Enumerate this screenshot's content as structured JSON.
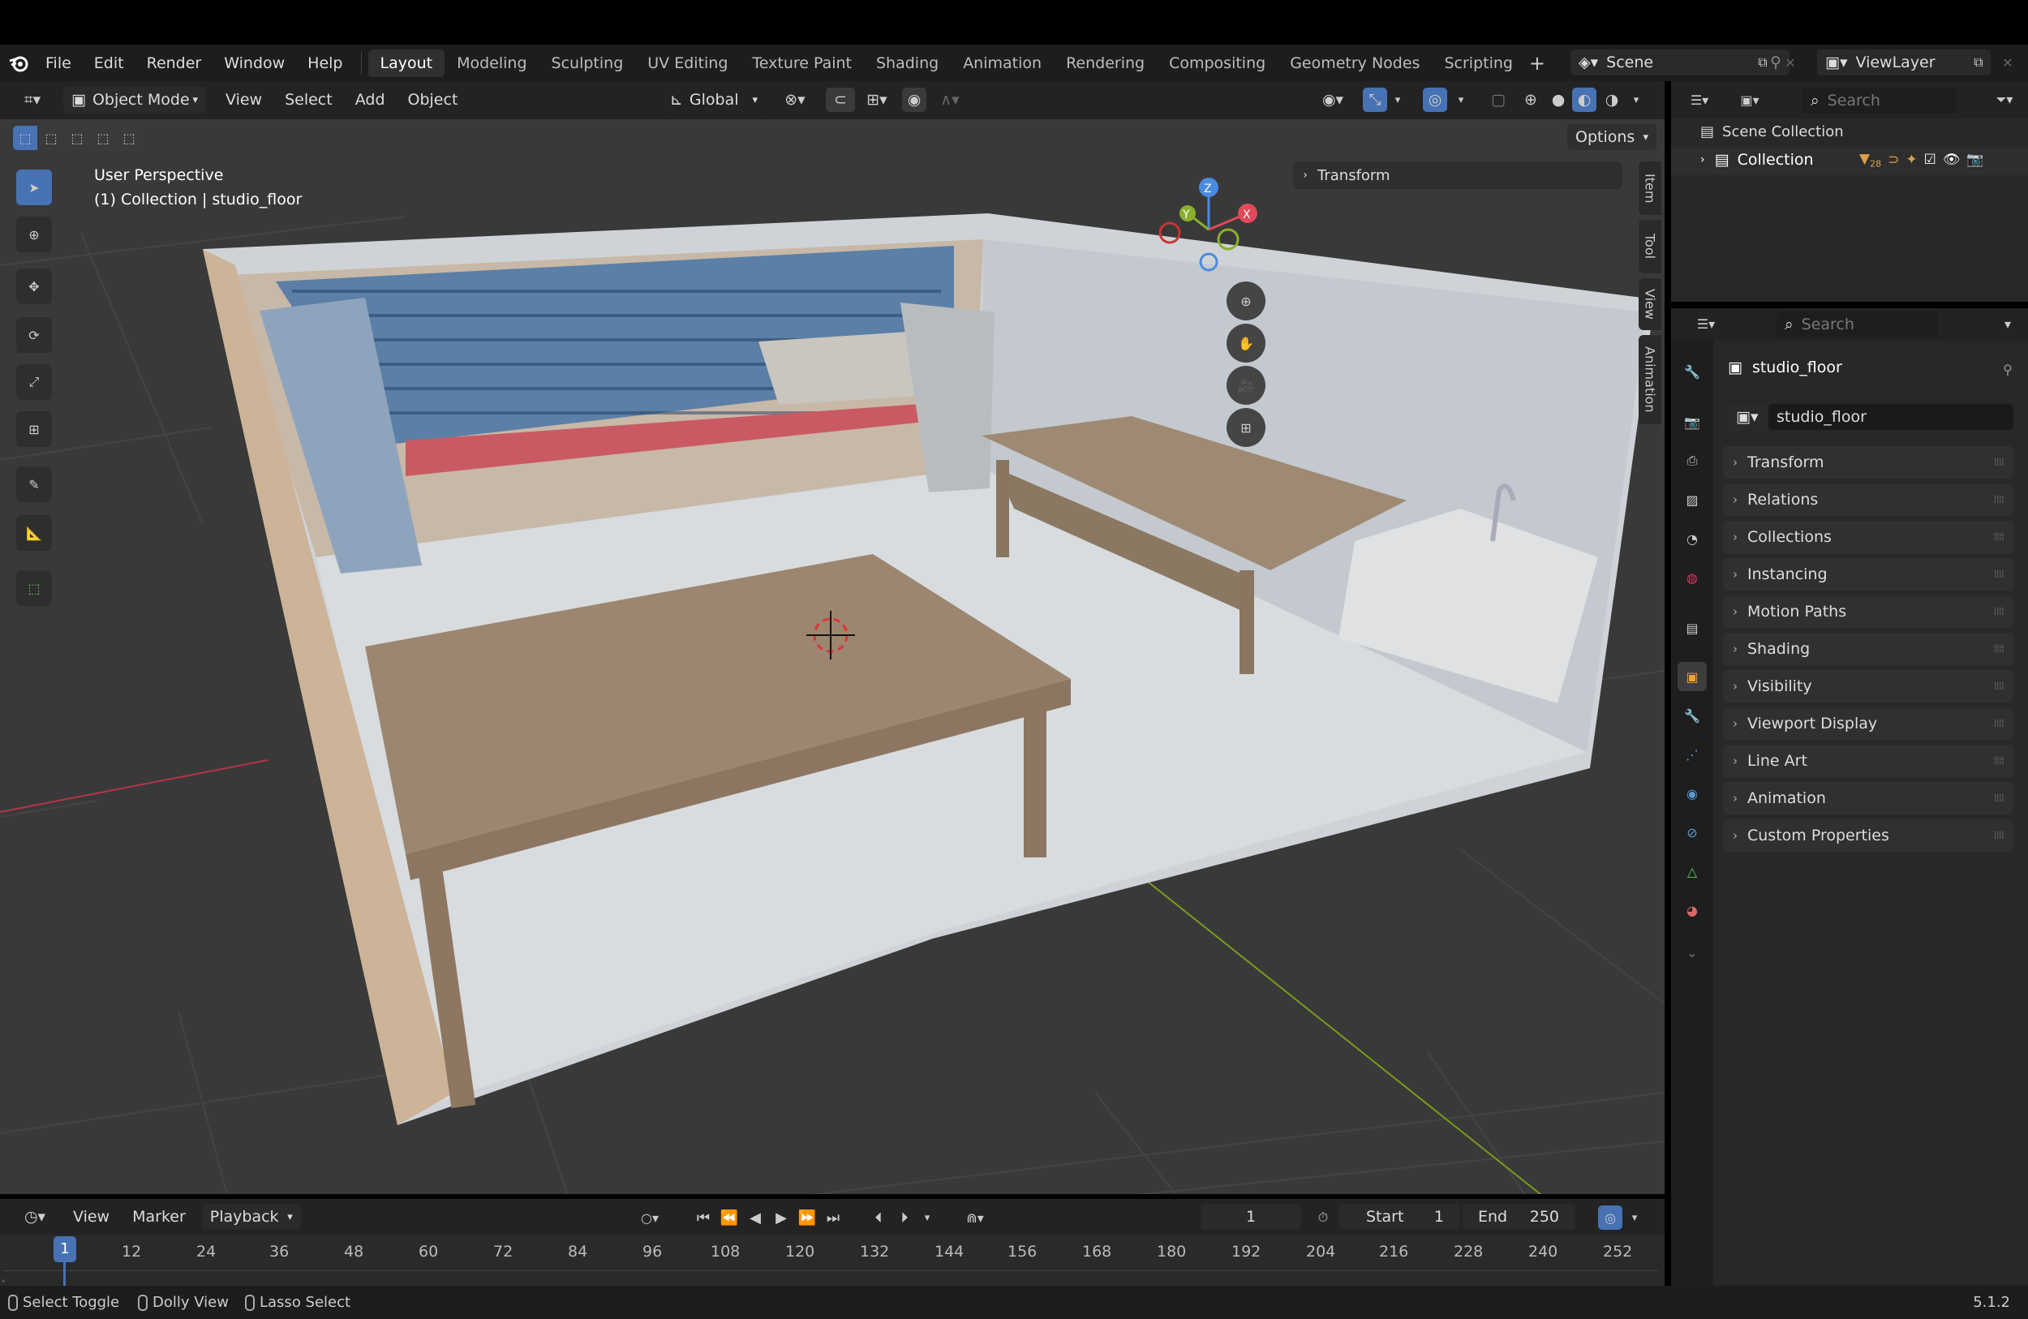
{
  "menu": [
    "File",
    "Edit",
    "Render",
    "Window",
    "Help"
  ],
  "workspaces": [
    "Layout",
    "Modeling",
    "Sculpting",
    "UV Editing",
    "Texture Paint",
    "Shading",
    "Animation",
    "Rendering",
    "Compositing",
    "Geometry Nodes",
    "Scripting"
  ],
  "active_workspace": "Layout",
  "scene_name": "Scene",
  "view_layer": "ViewLayer",
  "viewport_header": {
    "mode": "Object Mode",
    "menus": [
      "View",
      "Select",
      "Add",
      "Object"
    ],
    "orientation": "Global",
    "options_label": "Options"
  },
  "viewport": {
    "perspective": "User Perspective",
    "context": "(1) Collection | studio_floor",
    "transform_panel": "Transform",
    "side_tabs": [
      "Item",
      "Tool",
      "View",
      "Animation"
    ],
    "gizmo": {
      "x": "X",
      "y": "Y",
      "z": "Z"
    }
  },
  "outliner": {
    "search_placeholder": "Search",
    "scene_collection": "Scene Collection",
    "collection": "Collection",
    "collection_badge": "28"
  },
  "properties": {
    "search_placeholder": "Search",
    "object_name": "studio_floor",
    "datablock_name": "studio_floor",
    "panels": [
      "Transform",
      "Relations",
      "Collections",
      "Instancing",
      "Motion Paths",
      "Shading",
      "Visibility",
      "Viewport Display",
      "Line Art",
      "Animation",
      "Custom Properties"
    ]
  },
  "timeline": {
    "menus": [
      "View",
      "Marker"
    ],
    "playback_label": "Playback",
    "current_frame": "1",
    "start_label": "Start",
    "start_value": "1",
    "end_label": "End",
    "end_value": "250",
    "ticks": [
      "12",
      "24",
      "36",
      "48",
      "60",
      "72",
      "84",
      "96",
      "108",
      "120",
      "132",
      "144",
      "156",
      "168",
      "180",
      "192",
      "204",
      "216",
      "228",
      "240",
      "252"
    ],
    "playhead_label": "1"
  },
  "status": {
    "items": [
      "Select Toggle",
      "Dolly View",
      "Lasso Select"
    ],
    "version": "5.1.2"
  },
  "colors": {
    "accent": "#4772b3",
    "x_axis": "#e04a5a",
    "y_axis": "#8ab02b",
    "z_axis": "#4a8ae0"
  }
}
